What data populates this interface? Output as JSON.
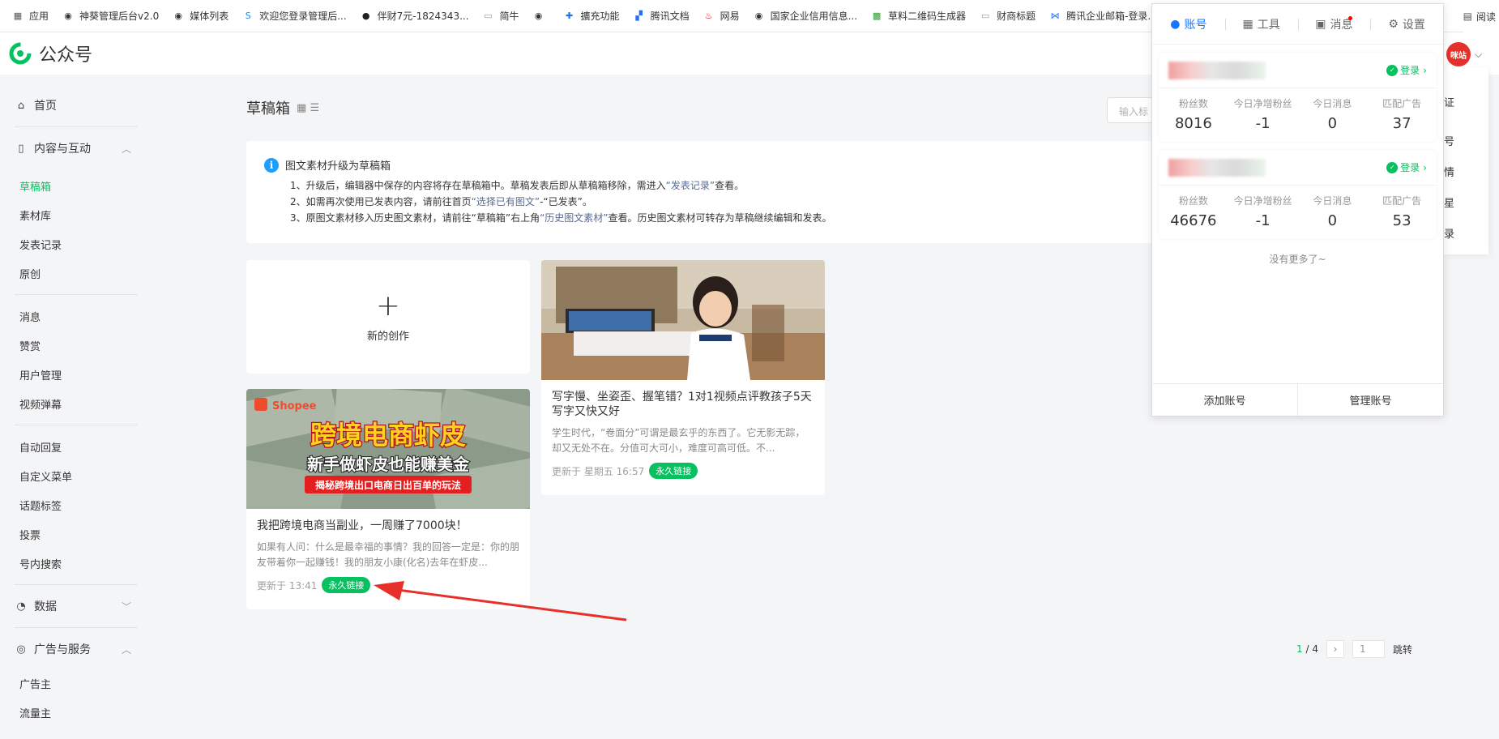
{
  "bookmarks": [
    {
      "label": "应用",
      "icon": "apps-icon",
      "color": "#555"
    },
    {
      "label": "神葵管理后台v2.0",
      "icon": "globe-icon",
      "color": "#333"
    },
    {
      "label": "媒体列表",
      "icon": "globe-icon",
      "color": "#333"
    },
    {
      "label": "欢迎您登录管理后...",
      "icon": "s-logo-icon",
      "color": "#1e88e5"
    },
    {
      "label": "伴财7元-1824343...",
      "icon": "play-circle-icon",
      "color": "#222"
    },
    {
      "label": "简牛",
      "icon": "page-icon",
      "color": "#999"
    },
    {
      "label": "",
      "icon": "globe-icon",
      "color": "#333"
    },
    {
      "label": "擴充功能",
      "icon": "puzzle-icon",
      "color": "#1a73e8"
    },
    {
      "label": "腾讯文档",
      "icon": "docs-icon",
      "color": "#1e6fff"
    },
    {
      "label": "网易",
      "icon": "netease-icon",
      "color": "#e60012"
    },
    {
      "label": "国家企业信用信息...",
      "icon": "globe-icon",
      "color": "#333"
    },
    {
      "label": "草料二维码生成器",
      "icon": "qr-icon",
      "color": "#2e9d32"
    },
    {
      "label": "财商标题",
      "icon": "page-icon",
      "color": "#999"
    },
    {
      "label": "腾讯企业邮箱-登录...",
      "icon": "mail-icon",
      "color": "#1e6fff"
    }
  ],
  "bookmarks_right": "阅读",
  "header": {
    "logo_text": "公众号",
    "avatar_text": "咪站",
    "brand_color": "#07c160"
  },
  "sidebar": {
    "home": "首页",
    "content_group": "内容与互动",
    "content_items": [
      "草稿箱",
      "素材库",
      "发表记录",
      "原创"
    ],
    "interaction_items": [
      "消息",
      "赞赏",
      "用户管理",
      "视频弹幕"
    ],
    "feature_items": [
      "自动回复",
      "自定义菜单",
      "话题标签",
      "投票",
      "号内搜索"
    ],
    "data_group": "数据",
    "ad_group": "广告与服务",
    "ad_items": [
      "广告主",
      "流量主"
    ]
  },
  "main": {
    "title": "草稿箱",
    "search_placeholder": "输入标",
    "notice": {
      "title": "图文素材升级为草稿箱",
      "line1_a": "1、升级后，编辑器中保存的内容将存在草稿箱中。草稿发表后即从草稿箱移除，需进入",
      "line1_link": "“发表记录”",
      "line1_b": "查看。",
      "line2_a": "2、如需再次使用已发表内容，请前往首页",
      "line2_link": "“选择已有图文”",
      "line2_b": "-“已发表”。",
      "line3_a": "3、原图文素材移入历史图文素材，请前往“草稿箱”右上角",
      "line3_link": "“历史图文素材”",
      "line3_b": "查看。历史图文素材可转存为草稿继续编辑和发表。"
    },
    "new_creation": "新的创作",
    "articles": [
      {
        "title": "写字慢、坐姿歪、握笔错？1对1视频点评教孩子5天写字又快又好",
        "desc": "学生时代，“卷面分”可谓是最玄乎的东西了。它无影无踪，却又无处不在。分值可大可小，难度可高可低。不...",
        "updated": "更新于 星期五 16:57",
        "badge": "永久链接"
      },
      {
        "title": "我把跨境电商当副业，一周赚了7000块！",
        "desc": "如果有人问：什么是最幸福的事情？我的回答一定是：你的朋友带着你一起赚钱！我的朋友小康(化名)去年在虾皮...",
        "updated": "更新于 13:41",
        "badge": "永久链接",
        "cover_brand": "Shopee",
        "cover_headline": "跨境电商虾皮",
        "cover_sub": "新手做虾皮也能赚美金",
        "cover_banner": "揭秘跨境出口电商日出百单的玩法"
      }
    ],
    "pager": {
      "current": "1",
      "total": "/ 4",
      "next": "›",
      "input": "1",
      "jump": "跳转"
    }
  },
  "popup": {
    "tabs": [
      {
        "label": "账号",
        "icon": "user-icon"
      },
      {
        "label": "工具",
        "icon": "grid-icon"
      },
      {
        "label": "消息",
        "icon": "chat-icon"
      },
      {
        "label": "设置",
        "icon": "gear-icon"
      }
    ],
    "login_label": "登录",
    "stat_labels": [
      "粉丝数",
      "今日净增粉丝",
      "今日消息",
      "匹配广告"
    ],
    "accounts": [
      {
        "values": [
          "8016",
          "-1",
          "0",
          "37"
        ]
      },
      {
        "values": [
          "46676",
          "-1",
          "0",
          "53"
        ]
      }
    ],
    "no_more": "没有更多了~",
    "add_account": "添加账号",
    "manage_account": "管理账号"
  },
  "behind_panel": [
    "证",
    "号",
    "情",
    "星",
    "录"
  ]
}
